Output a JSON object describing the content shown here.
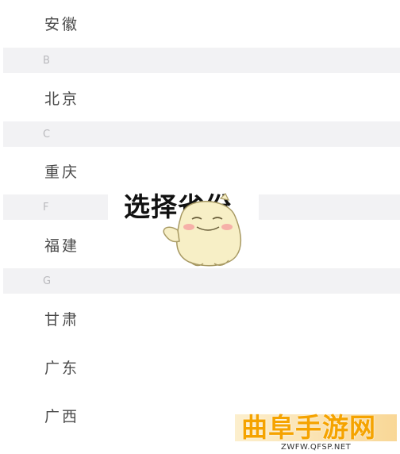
{
  "provinces": {
    "anhui": "安徽",
    "beijing": "北京",
    "chongqing": "重庆",
    "fujian": "福建",
    "gansu": "甘肃",
    "guangdong": "广东",
    "guangxi": "广西"
  },
  "letters": {
    "b": "B",
    "c": "C",
    "f": "F",
    "g": "G"
  },
  "overlay": {
    "title": "选择省份",
    "mascot": "duck-mascot-icon"
  },
  "watermark": {
    "brand": "曲阜手游网",
    "url": "ZWFW.QFSP.NET"
  },
  "colors": {
    "letter_band": "#f2f2f4",
    "province_text": "#4a4a4a",
    "watermark_brand": "#f5a300"
  }
}
